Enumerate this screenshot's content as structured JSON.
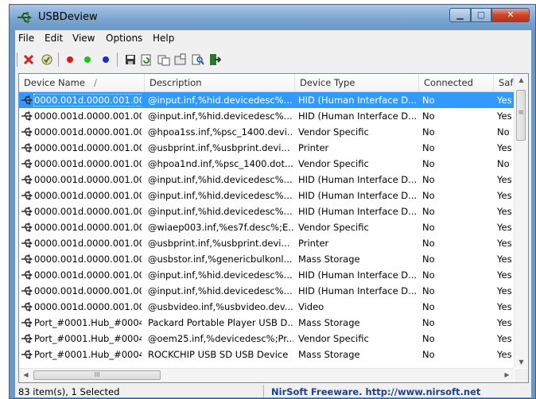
{
  "window": {
    "title": "USBDeview",
    "minimize_glyph": "▁",
    "maximize_glyph": "▢",
    "close_glyph": "✕"
  },
  "menu": [
    "File",
    "Edit",
    "View",
    "Options",
    "Help"
  ],
  "toolbar_icons": [
    "delete-icon",
    "disconnect-icon",
    "red-dot-icon",
    "green-dot-icon",
    "blue-dot-icon",
    "save-icon",
    "refresh-icon",
    "copy-icon",
    "properties-icon",
    "find-icon",
    "exit-icon"
  ],
  "columns": [
    "Device Name",
    "Description",
    "Device Type",
    "Connected",
    "Safe T"
  ],
  "sort_indicator": "/",
  "rows": [
    [
      "0000.001d.0000.001.00...",
      "@input.inf,%hid.devicedesc%...",
      "HID (Human Interface D...",
      "No",
      "Yes"
    ],
    [
      "0000.001d.0000.001.00...",
      "@input.inf,%hid.devicedesc%...",
      "HID (Human Interface D...",
      "No",
      "Yes"
    ],
    [
      "0000.001d.0000.001.00...",
      "@hpoa1ss.inf,%psc_1400.devi...",
      "Vendor Specific",
      "No",
      "No"
    ],
    [
      "0000.001d.0000.001.00...",
      "@usbprint.inf,%usbprint.devi...",
      "Printer",
      "No",
      "Yes"
    ],
    [
      "0000.001d.0000.001.00...",
      "@hpoa1nd.inf,%psc_1400.dot...",
      "Vendor Specific",
      "No",
      "No"
    ],
    [
      "0000.001d.0000.001.00...",
      "@input.inf,%hid.devicedesc%...",
      "HID (Human Interface D...",
      "No",
      "Yes"
    ],
    [
      "0000.001d.0000.001.00...",
      "@input.inf,%hid.devicedesc%...",
      "HID (Human Interface D...",
      "No",
      "Yes"
    ],
    [
      "0000.001d.0000.001.00...",
      "@input.inf,%hid.devicedesc%...",
      "HID (Human Interface D...",
      "No",
      "Yes"
    ],
    [
      "0000.001d.0000.001.00...",
      "@wiaep003.inf,%es7f.desc%;E...",
      "Vendor Specific",
      "No",
      "Yes"
    ],
    [
      "0000.001d.0000.001.00...",
      "@usbprint.inf,%usbprint.devi...",
      "Printer",
      "No",
      "Yes"
    ],
    [
      "0000.001d.0000.001.00...",
      "@usbstor.inf,%genericbulkonl...",
      "Mass Storage",
      "No",
      "Yes"
    ],
    [
      "0000.001d.0000.001.00...",
      "@input.inf,%hid.devicedesc%...",
      "HID (Human Interface D...",
      "No",
      "Yes"
    ],
    [
      "0000.001d.0000.001.00...",
      "@input.inf,%hid.devicedesc%...",
      "HID (Human Interface D...",
      "No",
      "Yes"
    ],
    [
      "0000.001d.0000.001.00...",
      "@usbvideo.inf,%usbvideo.dev...",
      "Video",
      "No",
      "Yes"
    ],
    [
      "Port_#0001.Hub_#0004",
      "Packard Portable Player USB D...",
      "Mass Storage",
      "No",
      "Yes"
    ],
    [
      "Port_#0001.Hub_#0004",
      "@oem25.inf,%devicedesc%;Pr...",
      "Vendor Specific",
      "No",
      "Yes"
    ],
    [
      "Port_#0001.Hub_#0004",
      "ROCKCHIP USB  SD USB Device",
      "Mass Storage",
      "No",
      "Yes"
    ]
  ],
  "selected_row": 0,
  "scroll": {
    "up": "▲",
    "down": "▼",
    "left": "◀",
    "right": "▶",
    "grip": "≡",
    "hgrip": "III"
  },
  "status": {
    "count": "83 item(s), 1 Selected",
    "link": "NirSoft Freeware.  http://www.nirsoft.net"
  }
}
